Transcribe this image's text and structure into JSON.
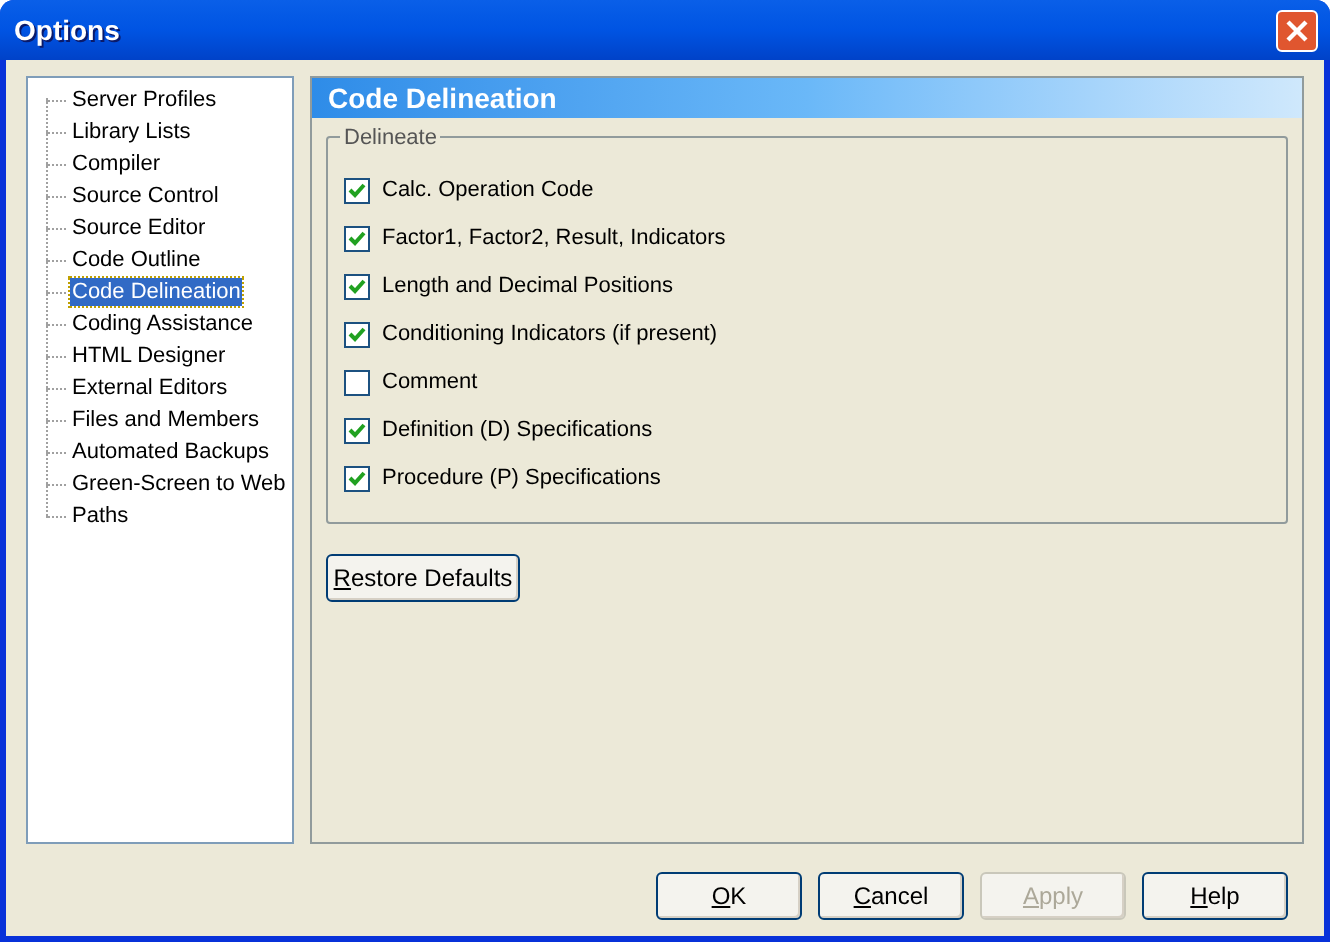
{
  "window": {
    "title": "Options"
  },
  "tree": {
    "items": [
      {
        "label": "Server Profiles",
        "selected": false
      },
      {
        "label": "Library Lists",
        "selected": false
      },
      {
        "label": "Compiler",
        "selected": false
      },
      {
        "label": "Source Control",
        "selected": false
      },
      {
        "label": "Source Editor",
        "selected": false
      },
      {
        "label": "Code Outline",
        "selected": false
      },
      {
        "label": "Code Delineation",
        "selected": true
      },
      {
        "label": "Coding Assistance",
        "selected": false
      },
      {
        "label": "HTML Designer",
        "selected": false
      },
      {
        "label": "External Editors",
        "selected": false
      },
      {
        "label": "Files and Members",
        "selected": false
      },
      {
        "label": "Automated Backups",
        "selected": false
      },
      {
        "label": "Green-Screen to Web",
        "selected": false
      },
      {
        "label": "Paths",
        "selected": false
      }
    ]
  },
  "panel": {
    "title": "Code Delineation",
    "group": {
      "label": "Delineate",
      "options": [
        {
          "label": "Calc. Operation Code",
          "checked": true
        },
        {
          "label": "Factor1, Factor2, Result, Indicators",
          "checked": true
        },
        {
          "label": "Length and Decimal Positions",
          "checked": true
        },
        {
          "label": "Conditioning Indicators (if present)",
          "checked": true
        },
        {
          "label": "Comment",
          "checked": false
        },
        {
          "label": "Definition (D) Specifications",
          "checked": true
        },
        {
          "label": "Procedure (P) Specifications",
          "checked": true
        }
      ]
    },
    "restore_button": {
      "key": "R",
      "rest": "estore Defaults",
      "disabled": false
    }
  },
  "buttons": [
    {
      "key": "O",
      "rest": "K",
      "disabled": false
    },
    {
      "key": "C",
      "rest": "ancel",
      "disabled": false
    },
    {
      "key": "A",
      "rest": "pply",
      "disabled": true
    },
    {
      "key": "H",
      "rest": "elp",
      "disabled": false
    }
  ]
}
